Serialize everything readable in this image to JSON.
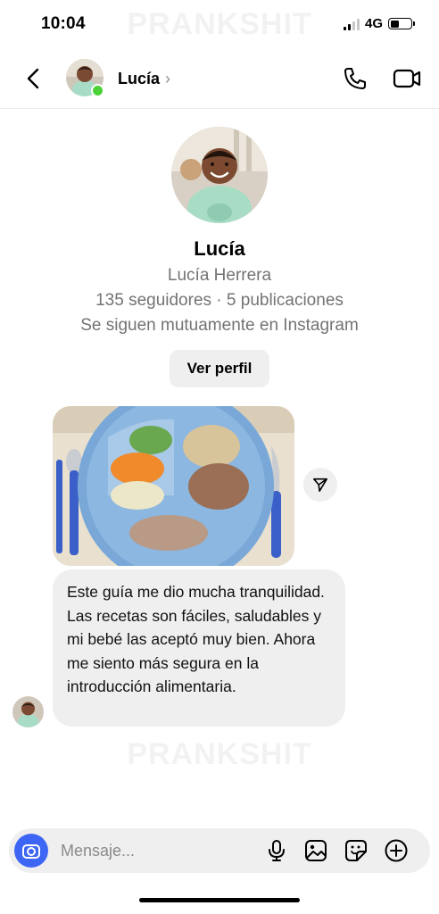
{
  "status": {
    "time": "10:04",
    "network": "4G"
  },
  "watermark": "PRANKSHIT",
  "header": {
    "name": "Lucía",
    "chevron": "›"
  },
  "profile": {
    "name": "Lucía",
    "full_name": "Lucía Herrera",
    "stats": "135 seguidores · 5 publicaciones",
    "mutual": "Se siguen mutuamente en Instagram",
    "view_profile_label": "Ver perfil"
  },
  "message": {
    "text": "Este guía me dio mucha tranquilidad. Las recetas son fáciles, saludables y mi bebé las aceptó muy bien. Ahora me siento más segura en la introducción alimentaria."
  },
  "composer": {
    "placeholder": "Mensaje..."
  },
  "icons": [
    "back-icon",
    "phone-icon",
    "video-camera-icon",
    "send-icon",
    "camera-icon",
    "microphone-icon",
    "gallery-icon",
    "sticker-icon",
    "plus-circle-icon"
  ],
  "colors": {
    "accent": "#3d66f5",
    "online": "#4cd137",
    "bubble": "#efefef",
    "secondary_text": "#737373"
  }
}
